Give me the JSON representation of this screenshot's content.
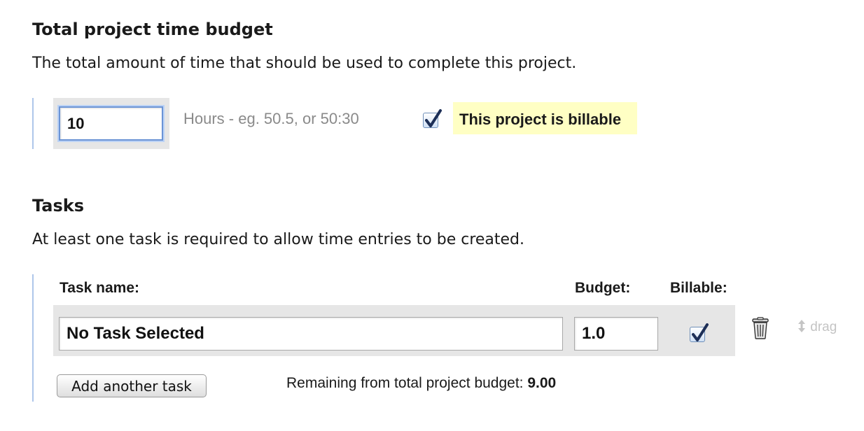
{
  "budget_section": {
    "title": "Total project time budget",
    "description": "The total amount of time that should be used to complete this project.",
    "hours_value": "10",
    "hours_hint": "Hours - eg. 50.5, or 50:30",
    "billable_checked": true,
    "billable_label": "This project is billable"
  },
  "tasks_section": {
    "title": "Tasks",
    "description": "At least one task is required to allow time entries to be created.",
    "headers": {
      "task_name": "Task name:",
      "budget": "Budget:",
      "billable": "Billable:"
    },
    "tasks": [
      {
        "name": "No Task Selected",
        "budget": "1.0",
        "billable": true,
        "delete_icon": "trash-icon",
        "drag_label": "drag",
        "drag_icon": "updown-arrow-icon"
      }
    ],
    "add_button_label": "Add another task",
    "remaining_label": "Remaining from total project budget:",
    "remaining_value": "9.00"
  }
}
